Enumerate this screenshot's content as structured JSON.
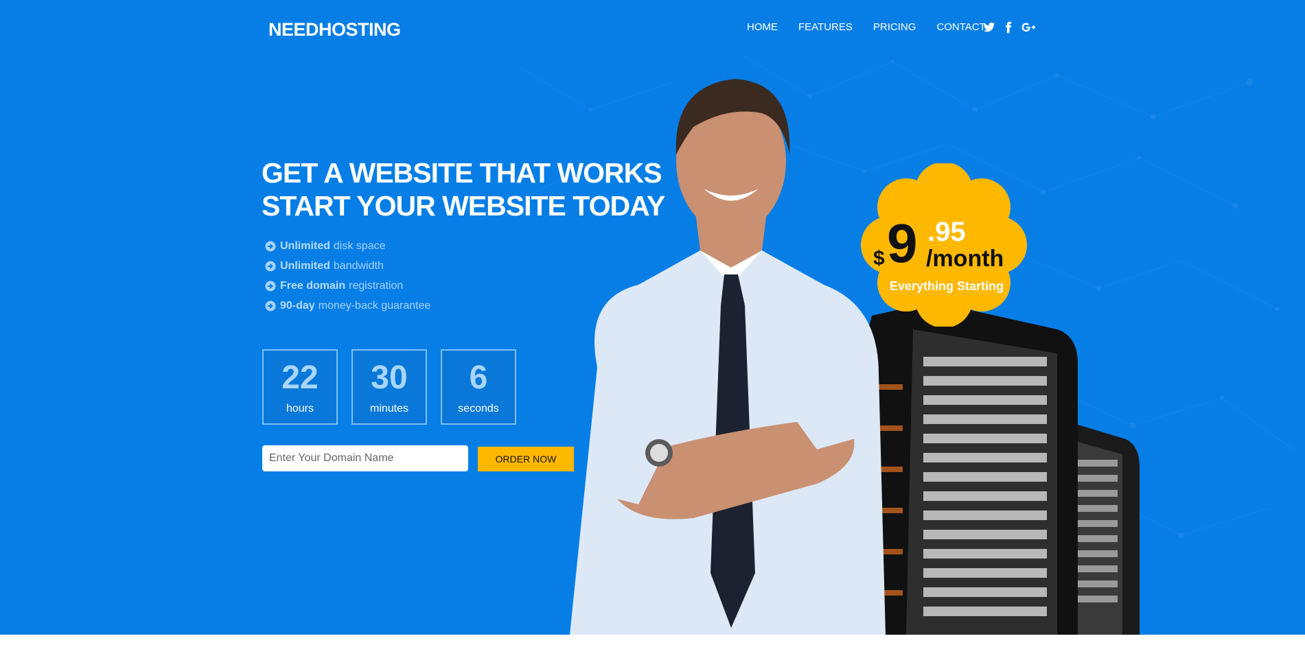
{
  "brand": "NEEDHOSTING",
  "nav": {
    "items": [
      {
        "label": "HOME"
      },
      {
        "label": "FEATURES"
      },
      {
        "label": "PRICING"
      },
      {
        "label": "CONTACT"
      }
    ],
    "social_icons": [
      "twitter-icon",
      "facebook-icon",
      "google-plus-icon"
    ]
  },
  "hero": {
    "headline_line1": "GET A WEBSITE THAT WORKS",
    "headline_line2": "START YOUR WEBSITE TODAY",
    "features": [
      {
        "bold": "Unlimited",
        "text": "disk space"
      },
      {
        "bold": "Unlimited",
        "text": "bandwidth"
      },
      {
        "bold": "Free domain",
        "text": "registration"
      },
      {
        "bold": "90-day",
        "text": "money-back guarantee"
      }
    ],
    "countdown": [
      {
        "value": "22",
        "label": "hours"
      },
      {
        "value": "30",
        "label": "minutes"
      },
      {
        "value": "6",
        "label": "seconds"
      }
    ],
    "domain_placeholder": "Enter Your Domain Name",
    "order_button": "ORDER NOW"
  },
  "price": {
    "currency": "$",
    "main": "9",
    "cents": ".95",
    "period": "/month",
    "caption": "Everything Starting"
  },
  "colors": {
    "hero_background": "#067ee6",
    "accent_yellow": "#ffb800",
    "feature_text": "#a7d3ff"
  }
}
